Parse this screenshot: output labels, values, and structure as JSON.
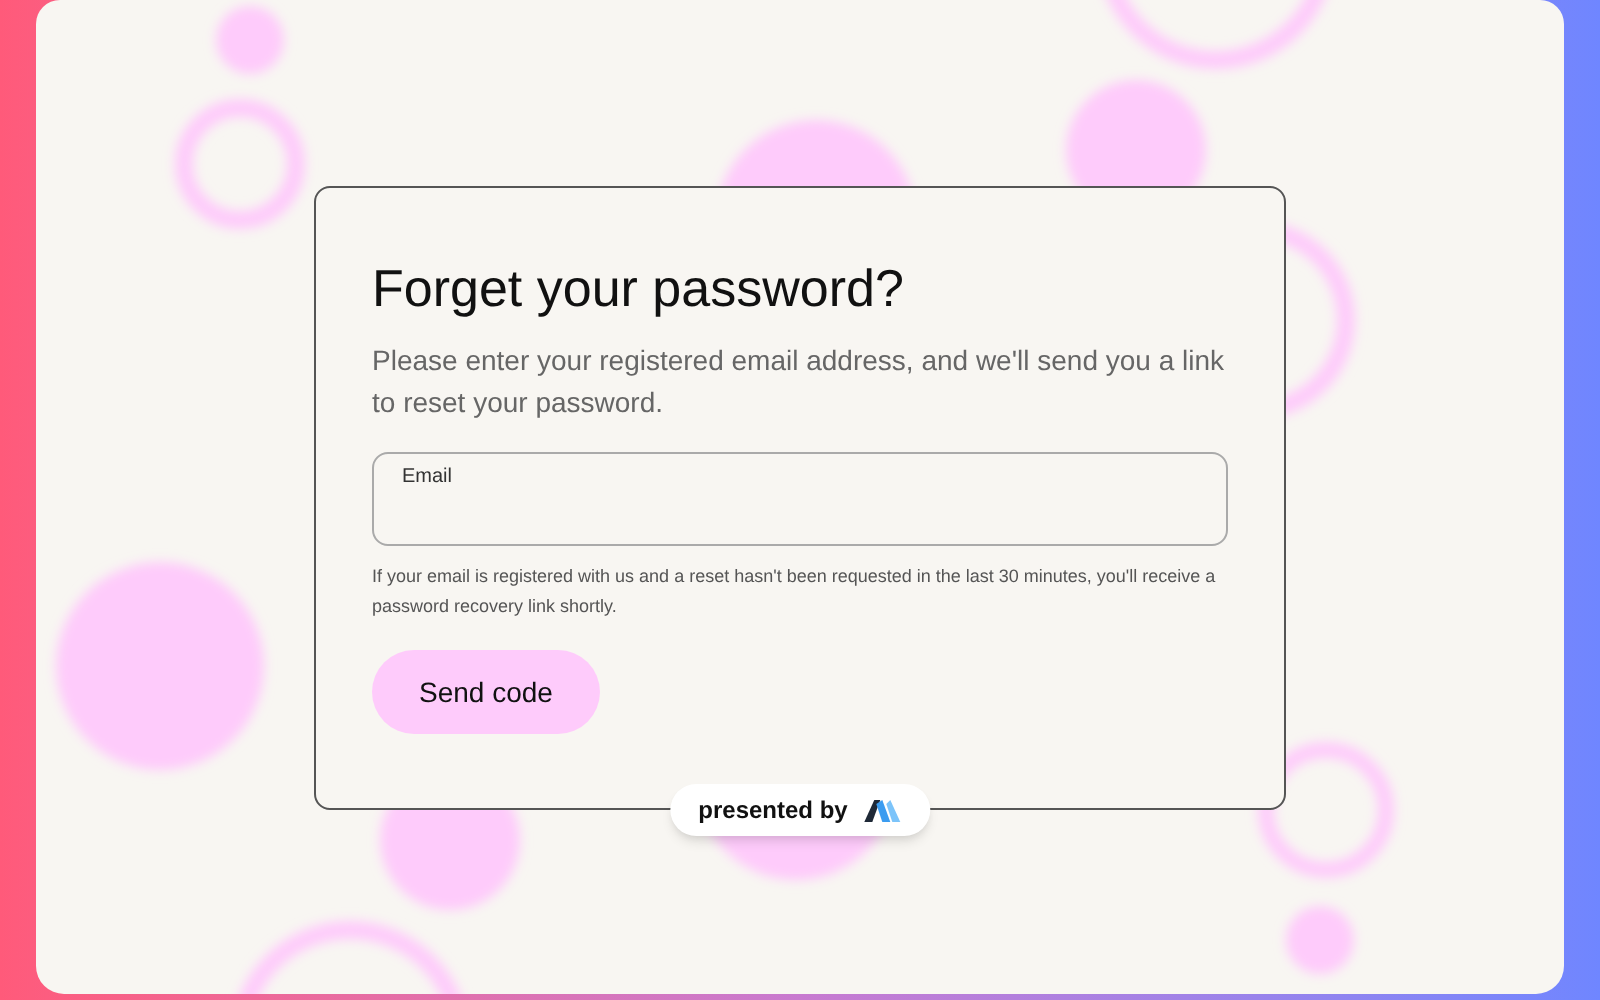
{
  "card": {
    "title": "Forget your password?",
    "description": "Please enter your registered email address, and we'll send you a link to reset your password.",
    "email_field": {
      "label": "Email"
    },
    "helper_text": "If your email is registered with us and a reset hasn't been requested in the last 30 minutes, you'll receive a password recovery link shortly.",
    "button": "Send code"
  },
  "badge": {
    "text": "presented by"
  }
}
